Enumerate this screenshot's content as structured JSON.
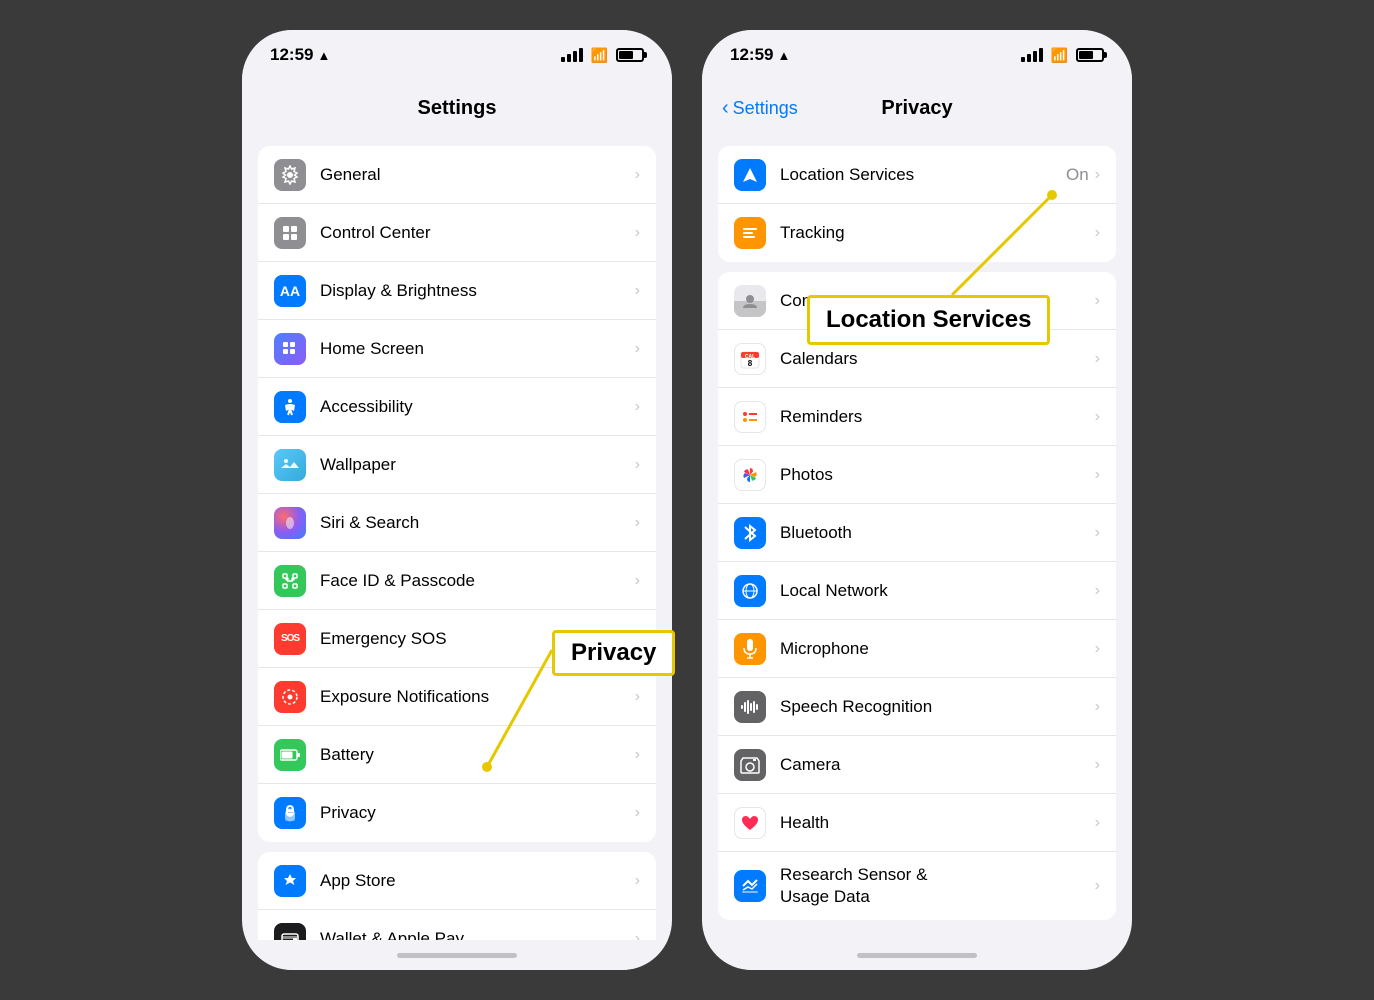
{
  "left_phone": {
    "status": {
      "time": "12:59",
      "location_arrow": "▲"
    },
    "header": {
      "title": "Settings"
    },
    "groups": [
      {
        "items": [
          {
            "id": "general",
            "icon_color": "gray",
            "icon": "⚙️",
            "label": "General",
            "value": ""
          },
          {
            "id": "control-center",
            "icon_color": "gray",
            "icon": "⊞",
            "label": "Control Center",
            "value": ""
          },
          {
            "id": "display-brightness",
            "icon_color": "blue",
            "icon": "AA",
            "label": "Display & Brightness",
            "value": ""
          },
          {
            "id": "home-screen",
            "icon_color": "indigo",
            "icon": "⊞",
            "label": "Home Screen",
            "value": ""
          },
          {
            "id": "accessibility",
            "icon_color": "blue",
            "icon": "♿",
            "label": "Accessibility",
            "value": ""
          },
          {
            "id": "wallpaper",
            "icon_color": "teal",
            "icon": "🌸",
            "label": "Wallpaper",
            "value": ""
          },
          {
            "id": "siri-search",
            "icon_color": "darkblue",
            "icon": "◉",
            "label": "Siri & Search",
            "value": ""
          },
          {
            "id": "face-id",
            "icon_color": "green",
            "icon": "👤",
            "label": "Face ID & Passcode",
            "value": ""
          },
          {
            "id": "emergency-sos",
            "icon_color": "red",
            "icon": "SOS",
            "label": "Emergency SOS",
            "value": ""
          },
          {
            "id": "exposure",
            "icon_color": "red",
            "icon": "⚬",
            "label": "Exposure Notifications",
            "value": ""
          },
          {
            "id": "battery",
            "icon_color": "green",
            "icon": "🔋",
            "label": "Battery",
            "value": ""
          },
          {
            "id": "privacy",
            "icon_color": "blue",
            "icon": "✋",
            "label": "Privacy",
            "value": ""
          }
        ]
      },
      {
        "items": [
          {
            "id": "app-store",
            "icon_color": "blue",
            "icon": "A",
            "label": "App Store",
            "value": ""
          },
          {
            "id": "wallet",
            "icon_color": "black",
            "icon": "▤",
            "label": "Wallet & Apple Pay",
            "value": ""
          }
        ]
      }
    ],
    "annotation": {
      "label": "Privacy"
    }
  },
  "right_phone": {
    "status": {
      "time": "12:59",
      "location_arrow": "▲"
    },
    "header": {
      "title": "Privacy",
      "back_label": "Settings"
    },
    "groups": [
      {
        "items": [
          {
            "id": "location-services",
            "icon_color": "blue",
            "icon": "➤",
            "label": "Location Services",
            "value": "On",
            "has_value": true
          },
          {
            "id": "tracking",
            "icon_color": "orange",
            "icon": "☰",
            "label": "Tracking",
            "value": ""
          }
        ]
      },
      {
        "items": [
          {
            "id": "contacts",
            "icon_color": "contacts",
            "icon": "👤",
            "label": "Contacts",
            "value": ""
          },
          {
            "id": "calendars",
            "icon_color": "red",
            "icon": "📅",
            "label": "Calendars",
            "value": ""
          },
          {
            "id": "reminders",
            "icon_color": "white",
            "icon": "•",
            "label": "Reminders",
            "value": ""
          },
          {
            "id": "photos",
            "icon_color": "white",
            "icon": "🌸",
            "label": "Photos",
            "value": ""
          },
          {
            "id": "bluetooth",
            "icon_color": "blue",
            "icon": "Ƀ",
            "label": "Bluetooth",
            "value": ""
          },
          {
            "id": "local-network",
            "icon_color": "blue",
            "icon": "🌐",
            "label": "Local Network",
            "value": ""
          },
          {
            "id": "microphone",
            "icon_color": "orange",
            "icon": "🎙️",
            "label": "Microphone",
            "value": ""
          },
          {
            "id": "speech-recognition",
            "icon_color": "darkgray",
            "icon": "🎵",
            "label": "Speech Recognition",
            "value": ""
          },
          {
            "id": "camera",
            "icon_color": "darkgray",
            "icon": "📷",
            "label": "Camera",
            "value": ""
          },
          {
            "id": "health",
            "icon_color": "white",
            "icon": "❤️",
            "label": "Health",
            "value": ""
          },
          {
            "id": "research-sensor",
            "icon_color": "blue",
            "icon": "⇄",
            "label": "Research Sensor &\nUsage Data",
            "value": "",
            "multiline": true
          }
        ]
      }
    ],
    "annotation": {
      "label": "Location Services"
    }
  },
  "icons": {
    "chevron": "›",
    "back_arrow": "‹"
  }
}
